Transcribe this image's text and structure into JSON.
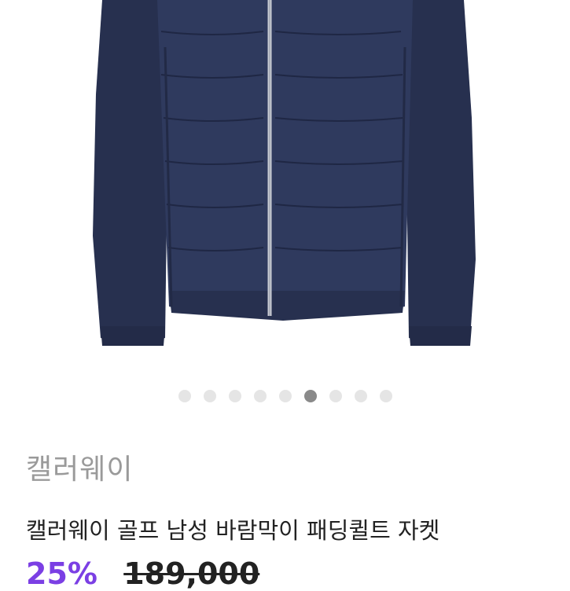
{
  "product": {
    "brand": "캘러웨이",
    "title": "캘러웨이 골프 남성 바람막이 패딩퀼트 자켓",
    "discount": "25%",
    "original_price": "189,000"
  },
  "gallery": {
    "total_images": 9,
    "current_index": 6
  },
  "colors": {
    "jacket": "#2b3556",
    "accent_discount": "#7b3fe4"
  }
}
